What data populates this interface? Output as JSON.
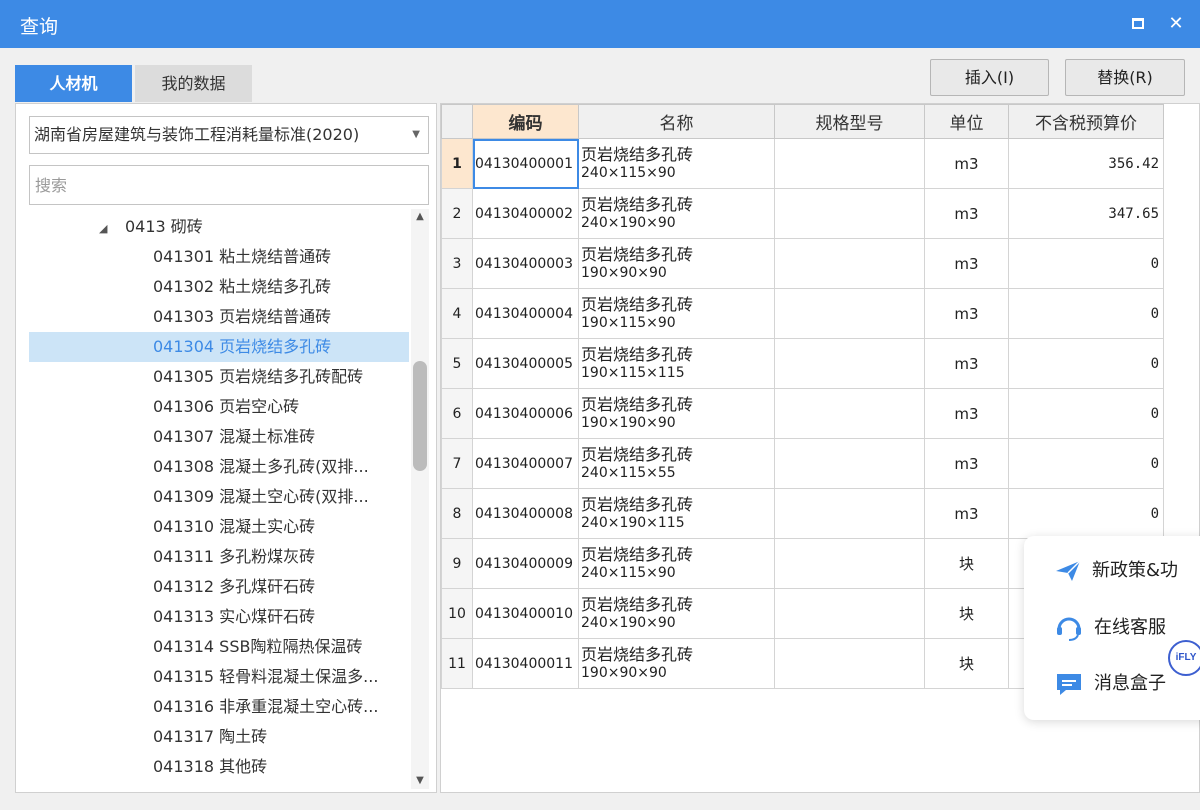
{
  "window": {
    "title": "查询",
    "maximize_label": "□",
    "close_label": "✕"
  },
  "tabs": {
    "labor_material": "人材机",
    "my_data": "我的数据"
  },
  "actions": {
    "insert_label": "插入(I)",
    "replace_label": "替换(R)"
  },
  "library": {
    "selected": "湖南省房屋建筑与装饰工程消耗量标准(2020)"
  },
  "search": {
    "placeholder": "搜索",
    "value": ""
  },
  "tree": {
    "parent_label": "0413 砌砖",
    "items": [
      {
        "label": "041301 粘土烧结普通砖"
      },
      {
        "label": "041302 粘土烧结多孔砖"
      },
      {
        "label": "041303 页岩烧结普通砖"
      },
      {
        "label": "041304 页岩烧结多孔砖"
      },
      {
        "label": "041305 页岩烧结多孔砖配砖"
      },
      {
        "label": "041306 页岩空心砖"
      },
      {
        "label": "041307 混凝土标准砖"
      },
      {
        "label": "041308 混凝土多孔砖(双排..."
      },
      {
        "label": "041309 混凝土空心砖(双排..."
      },
      {
        "label": "041310 混凝土实心砖"
      },
      {
        "label": "041311 多孔粉煤灰砖"
      },
      {
        "label": "041312 多孔煤矸石砖"
      },
      {
        "label": "041313 实心煤矸石砖"
      },
      {
        "label": "041314 SSB陶粒隔热保温砖"
      },
      {
        "label": "041315 轻骨料混凝土保温多..."
      },
      {
        "label": "041316 非承重混凝土空心砖..."
      },
      {
        "label": "041317 陶土砖"
      },
      {
        "label": "041318 其他砖"
      }
    ],
    "selected_index": 3
  },
  "table": {
    "headers": {
      "code": "编码",
      "name": "名称",
      "spec": "规格型号",
      "unit": "单位",
      "price": "不含税预算价"
    },
    "rows": [
      {
        "num": "1",
        "code": "04130400001",
        "name": "页岩烧结多孔砖",
        "spec": "240×115×90",
        "unit": "m3",
        "price": "356.42"
      },
      {
        "num": "2",
        "code": "04130400002",
        "name": "页岩烧结多孔砖",
        "spec": "240×190×90",
        "unit": "m3",
        "price": "347.65"
      },
      {
        "num": "3",
        "code": "04130400003",
        "name": "页岩烧结多孔砖",
        "spec": "190×90×90",
        "unit": "m3",
        "price": "0"
      },
      {
        "num": "4",
        "code": "04130400004",
        "name": "页岩烧结多孔砖",
        "spec": "190×115×90",
        "unit": "m3",
        "price": "0"
      },
      {
        "num": "5",
        "code": "04130400005",
        "name": "页岩烧结多孔砖",
        "spec": "190×115×115",
        "unit": "m3",
        "price": "0"
      },
      {
        "num": "6",
        "code": "04130400006",
        "name": "页岩烧结多孔砖",
        "spec": "190×190×90",
        "unit": "m3",
        "price": "0"
      },
      {
        "num": "7",
        "code": "04130400007",
        "name": "页岩烧结多孔砖",
        "spec": "240×115×55",
        "unit": "m3",
        "price": "0"
      },
      {
        "num": "8",
        "code": "04130400008",
        "name": "页岩烧结多孔砖",
        "spec": "240×190×115",
        "unit": "m3",
        "price": "0"
      },
      {
        "num": "9",
        "code": "04130400009",
        "name": "页岩烧结多孔砖",
        "spec": "240×115×90",
        "unit": "块",
        "price": ""
      },
      {
        "num": "10",
        "code": "04130400010",
        "name": "页岩烧结多孔砖",
        "spec": "240×190×90",
        "unit": "块",
        "price": ""
      },
      {
        "num": "11",
        "code": "04130400011",
        "name": "页岩烧结多孔砖",
        "spec": "190×90×90",
        "unit": "块",
        "price": ""
      }
    ]
  },
  "float_menu": {
    "policy": "新政策&功",
    "service": "在线客服",
    "messages": "消息盒子",
    "badge": "iFLY"
  },
  "colors": {
    "accent": "#3d8ae5",
    "selected_bg": "#cce4f7",
    "header_highlight": "#fde7cf"
  }
}
